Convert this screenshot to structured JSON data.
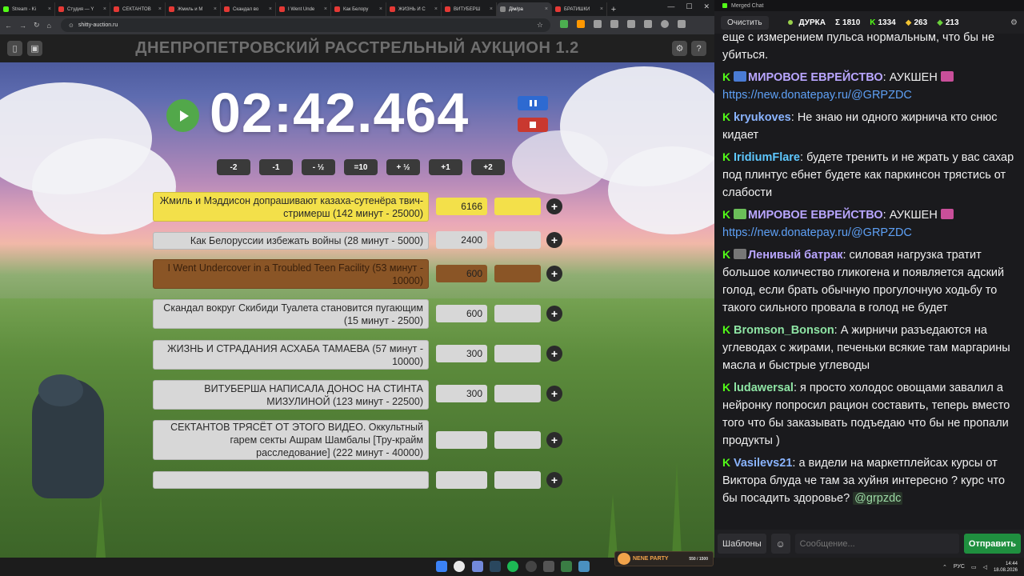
{
  "browser": {
    "tabs": [
      {
        "title": "Stream - Ki",
        "color": "#53fc18"
      },
      {
        "title": "Студия — Y",
        "color": "#e53935"
      },
      {
        "title": "СЕКТАНТОВ",
        "color": "#e53935"
      },
      {
        "title": "Жмиль и M",
        "color": "#e53935"
      },
      {
        "title": "Скандал во",
        "color": "#e53935"
      },
      {
        "title": "I Went Unde",
        "color": "#e53935"
      },
      {
        "title": "Как Белору",
        "color": "#e53935"
      },
      {
        "title": "ЖИЗНЬ И С",
        "color": "#e53935"
      },
      {
        "title": "ВИТУБЕРШ",
        "color": "#e53935"
      },
      {
        "title": "Дім/ра",
        "color": "#888888"
      },
      {
        "title": "БРАТИШКИ",
        "color": "#e53935"
      }
    ],
    "url": "shitty-auction.ru"
  },
  "app": {
    "title": "ДНЕПРОПЕТРОВСКИЙ РАССТРЕЛЬНЫЙ АУКЦИОН 1.2",
    "timer": "02:42.464",
    "adjust_buttons": [
      "-2",
      "-1",
      "- ½",
      "=10",
      "+ ½",
      "+1",
      "+2"
    ],
    "lots": [
      {
        "title": "Жмиль и Мэддисон допрашивают казаха-сутенёра твич-стримерш (142 минут - 25000)",
        "amount": "6166",
        "color": "#f3e04a",
        "plus": "+"
      },
      {
        "title": "Как Белоруссии избежать войны (28 минут - 5000)",
        "amount": "2400",
        "color": "#d7d7d7",
        "plus": "+"
      },
      {
        "title": "I Went Undercover in a Troubled Teen Facility (53 минут - 10000)",
        "amount": "600",
        "color": "#8a5526",
        "plus": "+"
      },
      {
        "title": "Скандал вокруг Скибиди Туалета становится пугающим (15 минут - 2500)",
        "amount": "600",
        "color": "#d7d7d7",
        "plus": "+"
      },
      {
        "title": "ЖИЗНЬ И СТРАДАНИЯ АСХАБА ТАМАЕВА (57 минут - 10000)",
        "amount": "300",
        "color": "#d7d7d7",
        "plus": "+"
      },
      {
        "title": "ВИТУБЕРША НАПИСАЛА ДОНОС НА СТИНТА МИЗУЛИНОЙ (123 минут - 22500)",
        "amount": "300",
        "color": "#d7d7d7",
        "plus": "+"
      },
      {
        "title": "СЕКТАНТОВ ТРЯСЁТ ОТ ЭТОГО ВИДЕО. Оккультный гарем секты Ашрам Шамбалы [Тру-крайм расследование] (222 минут - 40000)",
        "amount": "",
        "color": "#d7d7d7",
        "plus": "+"
      },
      {
        "title": "",
        "amount": "",
        "color": "#d7d7d7",
        "plus": "+"
      }
    ]
  },
  "chat": {
    "window_title": "Merged Chat",
    "clear_label": "Очистить",
    "streamer": "ДУРКА",
    "stats": [
      {
        "icon": "Σ",
        "value": "1810",
        "color": "#ffffff"
      },
      {
        "icon": "K",
        "value": "1334",
        "color": "#53fc18"
      },
      {
        "icon": "◆",
        "value": "263",
        "color": "#f1c232"
      },
      {
        "icon": "◆",
        "value": "213",
        "color": "#6ad13b"
      }
    ],
    "messages": [
      {
        "user": "",
        "user_color": "#ffffff",
        "text": "еще с измерением пульса нормальным, что бы не убиться.",
        "link": "",
        "mention": "",
        "badge": ""
      },
      {
        "user": "МИРОВОЕ ЕВРЕЙСТВО",
        "user_color": "#b9a6ff",
        "text": "АУКШЕН",
        "link": "https://new.donatepay.ru/@GRPZDC",
        "mention": "",
        "badge": "#4a7bd4"
      },
      {
        "user": "kryukoves",
        "user_color": "#8ab4ff",
        "text": "Не знаю ни одного жирнича кто снюс кидает",
        "link": "",
        "mention": "",
        "badge": ""
      },
      {
        "user": "IridiumFlare",
        "user_color": "#5ec8ff",
        "text": "будете тренить и не жрать у вас сахар под плинтус ебнет будете как паркинсон трястись от слабости",
        "link": "",
        "mention": "",
        "badge": ""
      },
      {
        "user": "МИРОВОЕ ЕВРЕЙСТВО",
        "user_color": "#b9a6ff",
        "text": "АУКШЕН",
        "link": "https://new.donatepay.ru/@GRPZDC",
        "mention": "",
        "badge": "#6bbf59"
      },
      {
        "user": "Ленивый батрак",
        "user_color": "#b9a6ff",
        "text": "силовая нагрузка тратит большое количество гликогена и появляется адский голод, если брать обычную прогулочную ходьбу то такого сильного провала в голод не будет",
        "link": "",
        "mention": "",
        "badge": "#777777"
      },
      {
        "user": "Bromson_Bonson",
        "user_color": "#8ee4a4",
        "text": "А жирничи разъедаются на углеводах с жирами, печеньки всякие там маргарины масла и быстрые углеводы",
        "link": "",
        "mention": "",
        "badge": ""
      },
      {
        "user": "ludawersal",
        "user_color": "#8ee4a4",
        "text": "я просто холодос овощами завалил а нейронку попросил рацион составить, теперь вместо того что бы заказывать подъедаю что бы не пропали продукты )",
        "link": "",
        "mention": "",
        "badge": ""
      },
      {
        "user": "Vasilevs21",
        "user_color": "#8ab4ff",
        "text": "а видели на маркетплейсах курсы от Виктора блуда че там за хуйня интересно ? курс что бы посадить здоровье?",
        "link": "",
        "mention": "@grpzdc",
        "badge": ""
      }
    ],
    "templates_label": "Шаблоны",
    "input_placeholder": "Сообщение...",
    "send_label": "Отправить"
  },
  "taskbar": {
    "banner_text": "NENE PARTY",
    "banner_value": "550 / 1500",
    "lang": "РУС",
    "time": "14:44",
    "date": "18.08.2026"
  }
}
